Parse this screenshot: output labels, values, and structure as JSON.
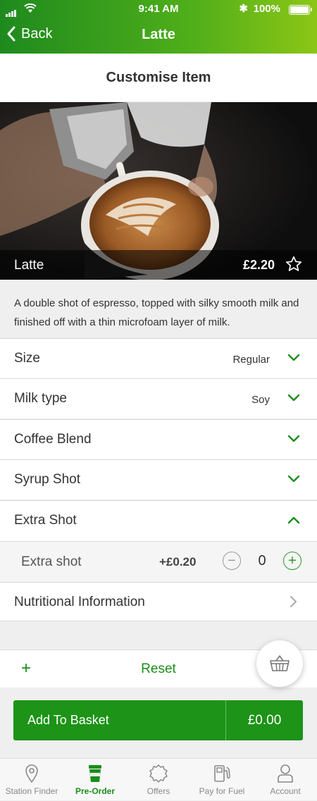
{
  "status": {
    "time": "9:41 AM",
    "battery": "100%"
  },
  "nav": {
    "back_label": "Back",
    "title": "Latte"
  },
  "subheader": {
    "title": "Customise Item"
  },
  "product": {
    "name": "Latte",
    "price": "£2.20",
    "description": "A double shot of espresso, topped with silky smooth milk and finished off with a thin microfoam layer of milk."
  },
  "options": [
    {
      "label": "Size",
      "value": "Regular",
      "expanded": false
    },
    {
      "label": "Milk type",
      "value": "Soy",
      "expanded": false
    },
    {
      "label": "Coffee Blend",
      "value": "",
      "expanded": false
    },
    {
      "label": "Syrup Shot",
      "value": "",
      "expanded": false
    },
    {
      "label": "Extra Shot",
      "value": "",
      "expanded": true
    }
  ],
  "extra_shot": {
    "label": "Extra shot",
    "price": "+£0.20",
    "quantity": "0",
    "minus": "−",
    "plus": "+"
  },
  "nutrition": {
    "label": "Nutritional Information"
  },
  "reset": {
    "plus": "+",
    "label": "Reset"
  },
  "add_to_basket": {
    "label": "Add To Basket",
    "total": "£0.00"
  },
  "tabs": [
    {
      "label": "Station Finder",
      "icon": "location-pin-icon",
      "active": false
    },
    {
      "label": "Pre-Order",
      "icon": "coffee-cup-icon",
      "active": true
    },
    {
      "label": "Offers",
      "icon": "offers-badge-icon",
      "active": false
    },
    {
      "label": "Pay for Fuel",
      "icon": "fuel-pump-icon",
      "active": false
    },
    {
      "label": "Account",
      "icon": "user-icon",
      "active": false
    }
  ],
  "colors": {
    "brand_green": "#1d9317",
    "header_gradient_end": "#8cc616"
  }
}
